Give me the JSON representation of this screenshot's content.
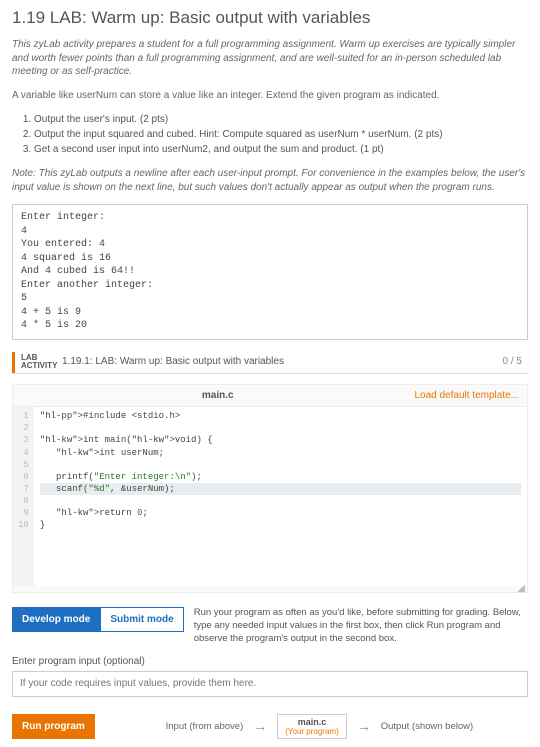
{
  "page": {
    "title": "1.19 LAB: Warm up: Basic output with variables",
    "intro": "This zyLab activity prepares a student for a full programming assignment. Warm up exercises are typically simpler and worth fewer points than a full programming assignment, and are well-suited for an in-person scheduled lab meeting or as self-practice.",
    "desc": "A variable like userNum can store a value like an integer. Extend the given program as indicated.",
    "steps": [
      "Output the user's input. (2 pts)",
      "Output the input squared and cubed. Hint: Compute squared as userNum * userNum. (2 pts)",
      "Get a second user input into userNum2, and output the sum and product. (1 pt)"
    ],
    "note": "Note: This zyLab outputs a newline after each user-input prompt. For convenience in the examples below, the user's input value is shown on the next line, but such values don't actually appear as output when the program runs.",
    "console": "Enter integer:\n4\nYou entered: 4\n4 squared is 16\nAnd 4 cubed is 64!!\nEnter another integer:\n5\n4 + 5 is 9\n4 * 5 is 20"
  },
  "activity": {
    "tag_line1": "LAB",
    "tag_line2": "ACTIVITY",
    "title": "1.19.1: LAB: Warm up: Basic output with variables",
    "score": "0 / 5"
  },
  "editor": {
    "filename": "main.c",
    "load_default": "Load default template...",
    "gutter": " 1\n 2\n 3\n 4\n 5\n 6\n 7\n 8\n 9\n10",
    "code_plain": "#include <stdio.h>\n\nint main(void) {\n   int userNum;\n\n   printf(\"Enter integer:\\n\");\n   scanf(\"%d\", &userNum);\n\n   return 0;\n}"
  },
  "modes": {
    "develop": "Develop mode",
    "submit": "Submit mode",
    "help": "Run your program as often as you'd like, before submitting for grading. Below, type any needed input values in the first box, then click Run program and observe the program's output in the second box."
  },
  "input": {
    "label": "Enter program input (optional)",
    "placeholder": "If your code requires input values, provide them here."
  },
  "run": {
    "button": "Run program",
    "input_label": "Input (from above)",
    "box_top": "main.c",
    "box_sub": "(Your program)",
    "output_label": "Output (shown below)"
  }
}
